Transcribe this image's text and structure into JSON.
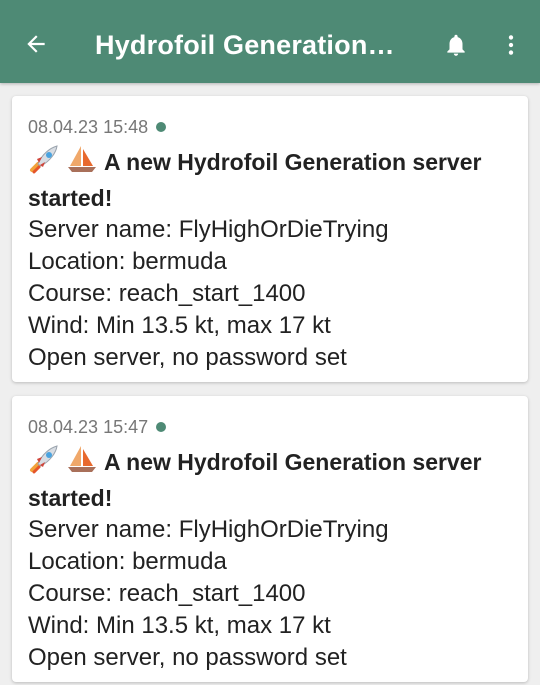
{
  "appbar": {
    "title": "Hydrofoil Generation…",
    "back_icon": "arrow-back-icon",
    "bell_icon": "bell-icon",
    "more_icon": "more-vert-icon",
    "background": "#4e8a75"
  },
  "status_color": "#4e8a75",
  "messages": [
    {
      "timestamp": "08.04.23 15:48",
      "headline": "A new Hydrofoil Generation server started!",
      "emoji_icons": [
        "rocket-icon",
        "sailboat-icon"
      ],
      "lines": [
        "Server name: FlyHighOrDieTrying",
        "Location: bermuda",
        "Course: reach_start_1400",
        "Wind: Min 13.5 kt, max 17 kt",
        "Open server, no password set"
      ]
    },
    {
      "timestamp": "08.04.23 15:47",
      "headline": "A new Hydrofoil Generation server started!",
      "emoji_icons": [
        "rocket-icon",
        "sailboat-icon"
      ],
      "lines": [
        "Server name: FlyHighOrDieTrying",
        "Location: bermuda",
        "Course: reach_start_1400",
        "Wind: Min 13.5 kt, max 17 kt",
        "Open server, no password set"
      ]
    }
  ]
}
